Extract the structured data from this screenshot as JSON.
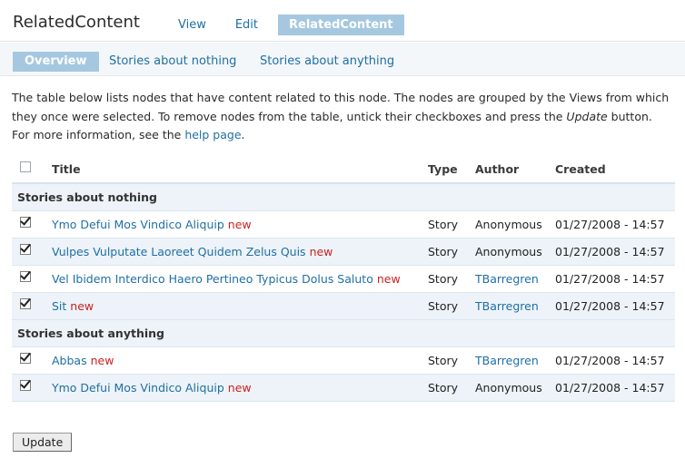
{
  "page": {
    "title": "RelatedContent"
  },
  "primary_tabs": [
    {
      "label": "View"
    },
    {
      "label": "Edit"
    },
    {
      "label": "RelatedContent"
    }
  ],
  "secondary_tabs": [
    {
      "label": "Overview"
    },
    {
      "label": "Stories about nothing"
    },
    {
      "label": "Stories about anything"
    }
  ],
  "intro": {
    "text_before": "The table below lists nodes that have content related to this node. The nodes are grouped by the Views from which they once were selected. To remove nodes from the table, untick their checkboxes and press the ",
    "update_word": "Update",
    "text_middle": " button. For more information, see the ",
    "link_text": "help page",
    "text_after": "."
  },
  "table": {
    "headers": {
      "title": "Title",
      "type": "Type",
      "author": "Author",
      "created": "Created"
    },
    "select_all_checked": false,
    "groups": [
      {
        "name": "Stories about nothing",
        "rows": [
          {
            "title": "Ymo Defui Mos Vindico Aliquip",
            "new": "new",
            "type": "Story",
            "author": "Anonymous",
            "author_link": false,
            "created": "01/27/2008 - 14:57",
            "checked": true
          },
          {
            "title": "Vulpes Vulputate Laoreet Quidem Zelus Quis",
            "new": "new",
            "type": "Story",
            "author": "Anonymous",
            "author_link": false,
            "created": "01/27/2008 - 14:57",
            "checked": true
          },
          {
            "title": "Vel Ibidem Interdico Haero Pertineo Typicus Dolus Saluto",
            "new": "new",
            "type": "Story",
            "author": "TBarregren",
            "author_link": true,
            "created": "01/27/2008 - 14:57",
            "checked": true
          },
          {
            "title": "Sit",
            "new": "new",
            "type": "Story",
            "author": "TBarregren",
            "author_link": true,
            "created": "01/27/2008 - 14:57",
            "checked": true
          }
        ]
      },
      {
        "name": "Stories about anything",
        "rows": [
          {
            "title": "Abbas",
            "new": "new",
            "type": "Story",
            "author": "TBarregren",
            "author_link": true,
            "created": "01/27/2008 - 14:57",
            "checked": true
          },
          {
            "title": "Ymo Defui Mos Vindico Aliquip",
            "new": "new",
            "type": "Story",
            "author": "Anonymous",
            "author_link": false,
            "created": "01/27/2008 - 14:57",
            "checked": true
          }
        ]
      }
    ]
  },
  "update_button": {
    "label": "Update"
  }
}
